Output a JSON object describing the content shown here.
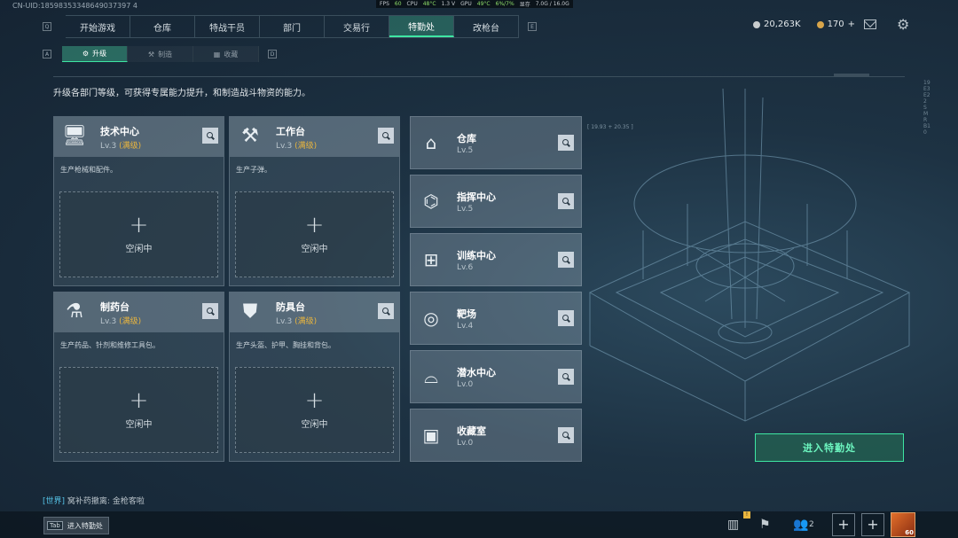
{
  "uid": "CN-UID:18598353348649037397 4",
  "perf": {
    "fps_label": "FPS",
    "fps": "60",
    "cpu_label": "CPU",
    "cpu_temp": "48°C",
    "volt": "1.3 V",
    "gpu_label": "GPU",
    "gpu_temp": "49°C",
    "gpu_usage": "6%/7%",
    "mem_label": "显存",
    "mem": "7.0G / 16.0G"
  },
  "topnav": {
    "left_key": "Q",
    "right_key": "E",
    "tabs": [
      "开始游戏",
      "仓库",
      "特战干员",
      "部门",
      "交易行",
      "特勤处",
      "改枪台"
    ],
    "active": "特勤处"
  },
  "currency": {
    "silver": "20,263K",
    "gold": "170",
    "gold_plus": "+"
  },
  "subnav": {
    "left_key": "A",
    "right_key": "D",
    "tabs": [
      {
        "label": "升级",
        "icon": "upgrade-icon"
      },
      {
        "label": "制造",
        "icon": "craft-icon"
      },
      {
        "label": "收藏",
        "icon": "collection-icon"
      }
    ],
    "active": "升级"
  },
  "description": "升级各部门等级，可获得专属能力提升，和制造战斗物资的能力。",
  "production_cards": [
    {
      "name": "技术中心",
      "level": "Lv.3",
      "max": "(满级)",
      "desc": "生产枪械和配件。",
      "slot_state": "空闲中",
      "icon": "tech-center-icon"
    },
    {
      "name": "工作台",
      "level": "Lv.3",
      "max": "(满级)",
      "desc": "生产子弹。",
      "slot_state": "空闲中",
      "icon": "workbench-icon"
    },
    {
      "name": "制药台",
      "level": "Lv.3",
      "max": "(满级)",
      "desc": "生产药品、针剂和维修工具包。",
      "slot_state": "空闲中",
      "icon": "pharmacy-icon"
    },
    {
      "name": "防具台",
      "level": "Lv.3",
      "max": "(满级)",
      "desc": "生产头盔、护甲、胸挂和背包。",
      "slot_state": "空闲中",
      "icon": "armor-bench-icon"
    }
  ],
  "side_cards": [
    {
      "name": "仓库",
      "level": "Lv.5",
      "icon": "warehouse-icon"
    },
    {
      "name": "指挥中心",
      "level": "Lv.5",
      "icon": "command-center-icon"
    },
    {
      "name": "训练中心",
      "level": "Lv.6",
      "icon": "training-center-icon"
    },
    {
      "name": "靶场",
      "level": "Lv.4",
      "icon": "shooting-range-icon"
    },
    {
      "name": "潜水中心",
      "level": "Lv.0",
      "icon": "diving-center-icon"
    },
    {
      "name": "收藏室",
      "level": "Lv.0",
      "icon": "collection-room-icon"
    }
  ],
  "enter_button": "进入特勤处",
  "chat": {
    "channel": "[世界]",
    "user": "窝补药撤离:",
    "message": "金枪客啦"
  },
  "bottom": {
    "tab_key": "Tab",
    "tab_label": "进入特勤处",
    "squad_count": "2",
    "badge": "!",
    "avatar_level": "60"
  },
  "decor": {
    "coord": "[ 19.93 + 20.35 ]",
    "vertical": "19 E3E22 SMRB10"
  }
}
